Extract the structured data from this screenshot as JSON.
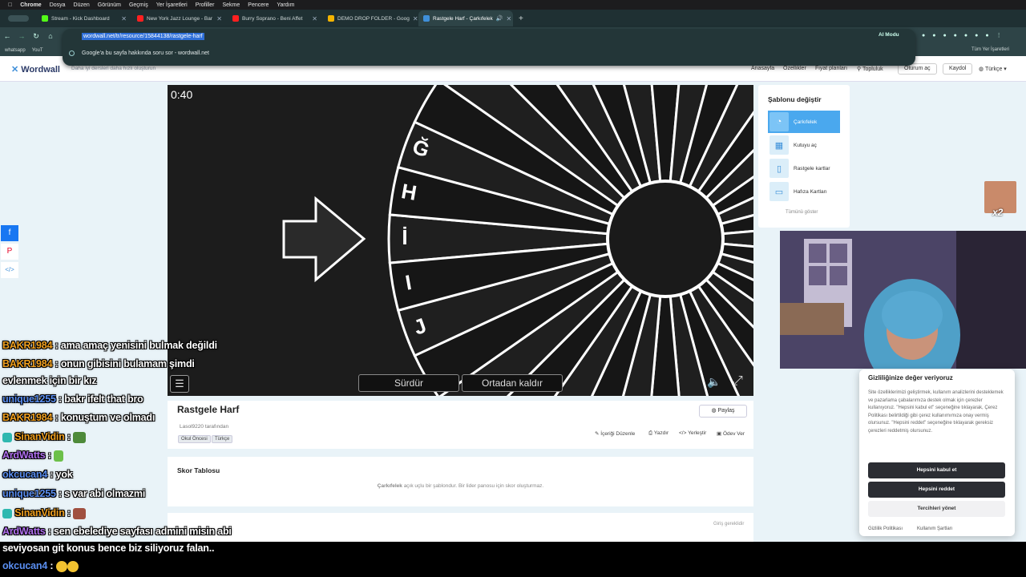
{
  "menubar": {
    "items": [
      "Chrome",
      "Dosya",
      "Düzen",
      "Görünüm",
      "Geçmiş",
      "Yer İşaretleri",
      "Profiller",
      "Sekme",
      "Pencere",
      "Yardım"
    ]
  },
  "tabs": [
    {
      "title": "Stream - Kick Dashboard",
      "color": "#53fc18"
    },
    {
      "title": "New York Jazz Lounge - Bar",
      "color": "#ff2020"
    },
    {
      "title": "Burry Soprano - Beni Affet",
      "color": "#ff2020"
    },
    {
      "title": "DEMO DROP FOLDER - Goog",
      "color": "#f4b400"
    },
    {
      "title": "Rastgele Harf - Çarkıfelek",
      "color": "#3f8fd9"
    }
  ],
  "omnibox": {
    "url": "wordwall.net/tr/resource/15844138/rastgele-harf",
    "suggestion": "Google'a bu sayfa hakkında soru sor - wordwall.net"
  },
  "toolbar": {
    "ai_mode": "AI Modu"
  },
  "bookmarks": {
    "items": [
      "whatsapp",
      "YouT"
    ],
    "all": "Tüm Yer İşaretleri"
  },
  "header": {
    "logo_a": "Word",
    "logo_b": "wall",
    "tagline": "Daha iyi dersleri daha hızlı oluşturun",
    "nav": [
      "Anasayfa",
      "Özellikler",
      "Fiyat planları",
      "Topluluk"
    ],
    "login": "Oturum aç",
    "signup": "Kaydol",
    "language": "Türkçe"
  },
  "game": {
    "timer": "0:40",
    "resume": "Sürdür",
    "remove": "Ortadan kaldır",
    "letters": [
      "J",
      "I",
      "İ",
      "H",
      "Ğ"
    ]
  },
  "activity": {
    "title": "Rastgele Harf",
    "author": "Lasol9220",
    "author_suffix": "tarafından",
    "tags": [
      "Okul Öncesi",
      "Türkçe"
    ],
    "share": "Paylaş",
    "actions": [
      "İçeriği Düzenle",
      "Yazdır",
      "Yerleştir",
      "Ödev Ver"
    ]
  },
  "scoreboard": {
    "title": "Skor Tablosu",
    "text_bold": "Çarkıfelek",
    "text": "açık uçlu bir şablondur. Bir lider panosu için skor oluşturmaz.",
    "login_required": "Giriş gereklidir"
  },
  "templates": {
    "title": "Şablonu değiştir",
    "items": [
      "Çarkıfelek",
      "Kutuyu aç",
      "Rastgele kartlar",
      "Hafıza Kartları"
    ],
    "show_all": "Tümünü göster"
  },
  "cookie": {
    "title": "Gizliliğinize değer veriyoruz",
    "text": "Site özelliklerimizi geliştirmek, kullanım analizlerini desteklemek ve pazarlama çabalarımıza destek olmak için çerezler kullanıyoruz. \"Hepsini kabul et\" seçeneğine tıklayarak, Çerez Politikası belirtildiği gibi çerez kullanımımıza onay vermiş olursunuz. \"Hepsini reddet\" seçeneğine tıklayarak gereksiz çerezleri reddetmiş olursunuz.",
    "accept": "Hepsini kabul et",
    "reject": "Hepsini reddet",
    "manage": "Tercihleri yönet",
    "privacy": "Gizlilik Politikası",
    "terms": "Kullanım Şartları"
  },
  "overlay": {
    "emote_text": "x2"
  },
  "chat": [
    {
      "user": "BAKR1984",
      "color": "#f0a020",
      "msg": " : ama amaç yenisini bulmak değildi"
    },
    {
      "user": "BAKR1984",
      "color": "#f0a020",
      "msg": " : onun gibisini bulamam şimdi"
    },
    {
      "user": "",
      "color": "#ffffff",
      "msg": "evlenmek için bir kız"
    },
    {
      "user": "unique1255",
      "color": "#5a8ef0",
      "msg": " : bakr ifelt that bro"
    },
    {
      "user": "BAKR1984",
      "color": "#f0a020",
      "msg": " : konuştum ve olmadı"
    },
    {
      "user": "SinanVidin",
      "color": "#f0a020",
      "msg": " : "
    },
    {
      "user": "ArdWatts",
      "color": "#b070f0",
      "msg": " : "
    },
    {
      "user": "okcucan4",
      "color": "#5a8ef0",
      "msg": " : yok"
    },
    {
      "user": "unique1255",
      "color": "#5a8ef0",
      "msg": " : s var abi olmazmi"
    },
    {
      "user": "SinanVidin",
      "color": "#f0a020",
      "msg": " : "
    },
    {
      "user": "ArdWatts",
      "color": "#b070f0",
      "msg": " : sen ebelediye sayfası admini misin abi"
    },
    {
      "user": "",
      "color": "#ffffff",
      "msg": "seviyosan git konus bence biz siliyoruz falan.."
    },
    {
      "user": "okcucan4",
      "color": "#5a8ef0",
      "msg": " : "
    }
  ]
}
